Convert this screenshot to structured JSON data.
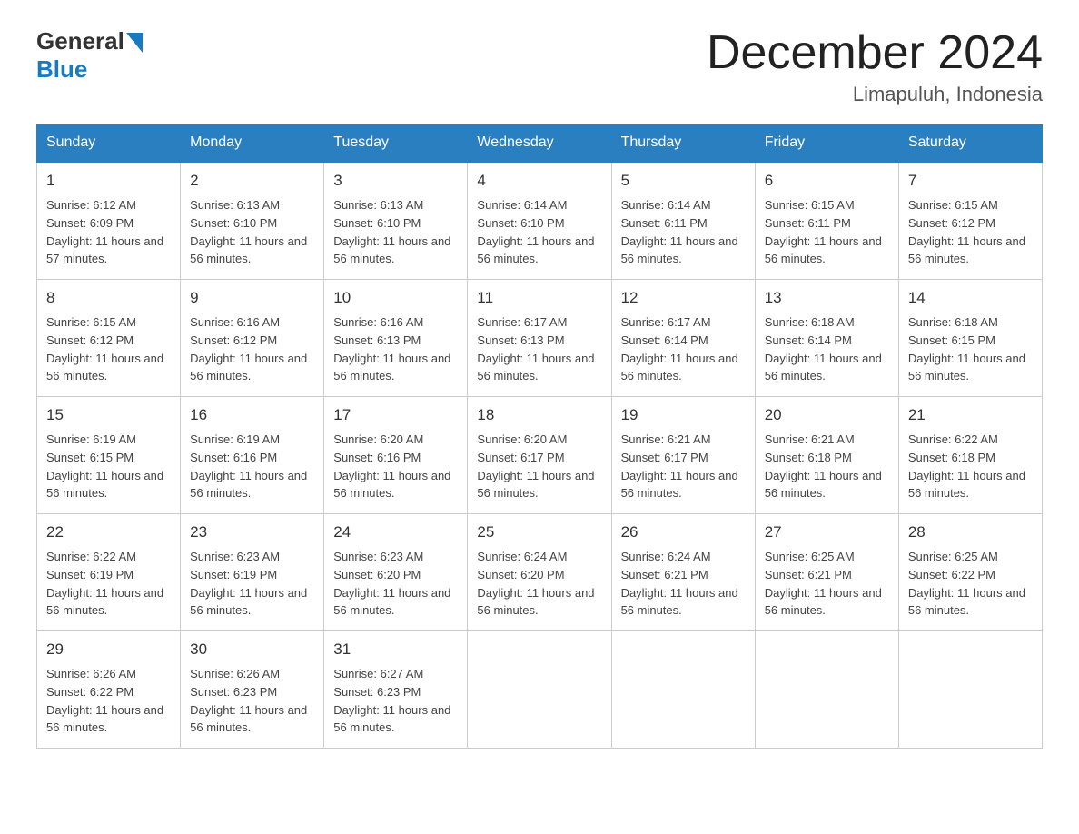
{
  "logo": {
    "text_general": "General",
    "text_blue": "Blue",
    "arrow": "▶"
  },
  "title": "December 2024",
  "subtitle": "Limapuluh, Indonesia",
  "days_header": [
    "Sunday",
    "Monday",
    "Tuesday",
    "Wednesday",
    "Thursday",
    "Friday",
    "Saturday"
  ],
  "weeks": [
    [
      {
        "num": "1",
        "sunrise": "6:12 AM",
        "sunset": "6:09 PM",
        "daylight": "11 hours and 57 minutes."
      },
      {
        "num": "2",
        "sunrise": "6:13 AM",
        "sunset": "6:10 PM",
        "daylight": "11 hours and 56 minutes."
      },
      {
        "num": "3",
        "sunrise": "6:13 AM",
        "sunset": "6:10 PM",
        "daylight": "11 hours and 56 minutes."
      },
      {
        "num": "4",
        "sunrise": "6:14 AM",
        "sunset": "6:10 PM",
        "daylight": "11 hours and 56 minutes."
      },
      {
        "num": "5",
        "sunrise": "6:14 AM",
        "sunset": "6:11 PM",
        "daylight": "11 hours and 56 minutes."
      },
      {
        "num": "6",
        "sunrise": "6:15 AM",
        "sunset": "6:11 PM",
        "daylight": "11 hours and 56 minutes."
      },
      {
        "num": "7",
        "sunrise": "6:15 AM",
        "sunset": "6:12 PM",
        "daylight": "11 hours and 56 minutes."
      }
    ],
    [
      {
        "num": "8",
        "sunrise": "6:15 AM",
        "sunset": "6:12 PM",
        "daylight": "11 hours and 56 minutes."
      },
      {
        "num": "9",
        "sunrise": "6:16 AM",
        "sunset": "6:12 PM",
        "daylight": "11 hours and 56 minutes."
      },
      {
        "num": "10",
        "sunrise": "6:16 AM",
        "sunset": "6:13 PM",
        "daylight": "11 hours and 56 minutes."
      },
      {
        "num": "11",
        "sunrise": "6:17 AM",
        "sunset": "6:13 PM",
        "daylight": "11 hours and 56 minutes."
      },
      {
        "num": "12",
        "sunrise": "6:17 AM",
        "sunset": "6:14 PM",
        "daylight": "11 hours and 56 minutes."
      },
      {
        "num": "13",
        "sunrise": "6:18 AM",
        "sunset": "6:14 PM",
        "daylight": "11 hours and 56 minutes."
      },
      {
        "num": "14",
        "sunrise": "6:18 AM",
        "sunset": "6:15 PM",
        "daylight": "11 hours and 56 minutes."
      }
    ],
    [
      {
        "num": "15",
        "sunrise": "6:19 AM",
        "sunset": "6:15 PM",
        "daylight": "11 hours and 56 minutes."
      },
      {
        "num": "16",
        "sunrise": "6:19 AM",
        "sunset": "6:16 PM",
        "daylight": "11 hours and 56 minutes."
      },
      {
        "num": "17",
        "sunrise": "6:20 AM",
        "sunset": "6:16 PM",
        "daylight": "11 hours and 56 minutes."
      },
      {
        "num": "18",
        "sunrise": "6:20 AM",
        "sunset": "6:17 PM",
        "daylight": "11 hours and 56 minutes."
      },
      {
        "num": "19",
        "sunrise": "6:21 AM",
        "sunset": "6:17 PM",
        "daylight": "11 hours and 56 minutes."
      },
      {
        "num": "20",
        "sunrise": "6:21 AM",
        "sunset": "6:18 PM",
        "daylight": "11 hours and 56 minutes."
      },
      {
        "num": "21",
        "sunrise": "6:22 AM",
        "sunset": "6:18 PM",
        "daylight": "11 hours and 56 minutes."
      }
    ],
    [
      {
        "num": "22",
        "sunrise": "6:22 AM",
        "sunset": "6:19 PM",
        "daylight": "11 hours and 56 minutes."
      },
      {
        "num": "23",
        "sunrise": "6:23 AM",
        "sunset": "6:19 PM",
        "daylight": "11 hours and 56 minutes."
      },
      {
        "num": "24",
        "sunrise": "6:23 AM",
        "sunset": "6:20 PM",
        "daylight": "11 hours and 56 minutes."
      },
      {
        "num": "25",
        "sunrise": "6:24 AM",
        "sunset": "6:20 PM",
        "daylight": "11 hours and 56 minutes."
      },
      {
        "num": "26",
        "sunrise": "6:24 AM",
        "sunset": "6:21 PM",
        "daylight": "11 hours and 56 minutes."
      },
      {
        "num": "27",
        "sunrise": "6:25 AM",
        "sunset": "6:21 PM",
        "daylight": "11 hours and 56 minutes."
      },
      {
        "num": "28",
        "sunrise": "6:25 AM",
        "sunset": "6:22 PM",
        "daylight": "11 hours and 56 minutes."
      }
    ],
    [
      {
        "num": "29",
        "sunrise": "6:26 AM",
        "sunset": "6:22 PM",
        "daylight": "11 hours and 56 minutes."
      },
      {
        "num": "30",
        "sunrise": "6:26 AM",
        "sunset": "6:23 PM",
        "daylight": "11 hours and 56 minutes."
      },
      {
        "num": "31",
        "sunrise": "6:27 AM",
        "sunset": "6:23 PM",
        "daylight": "11 hours and 56 minutes."
      },
      null,
      null,
      null,
      null
    ]
  ]
}
